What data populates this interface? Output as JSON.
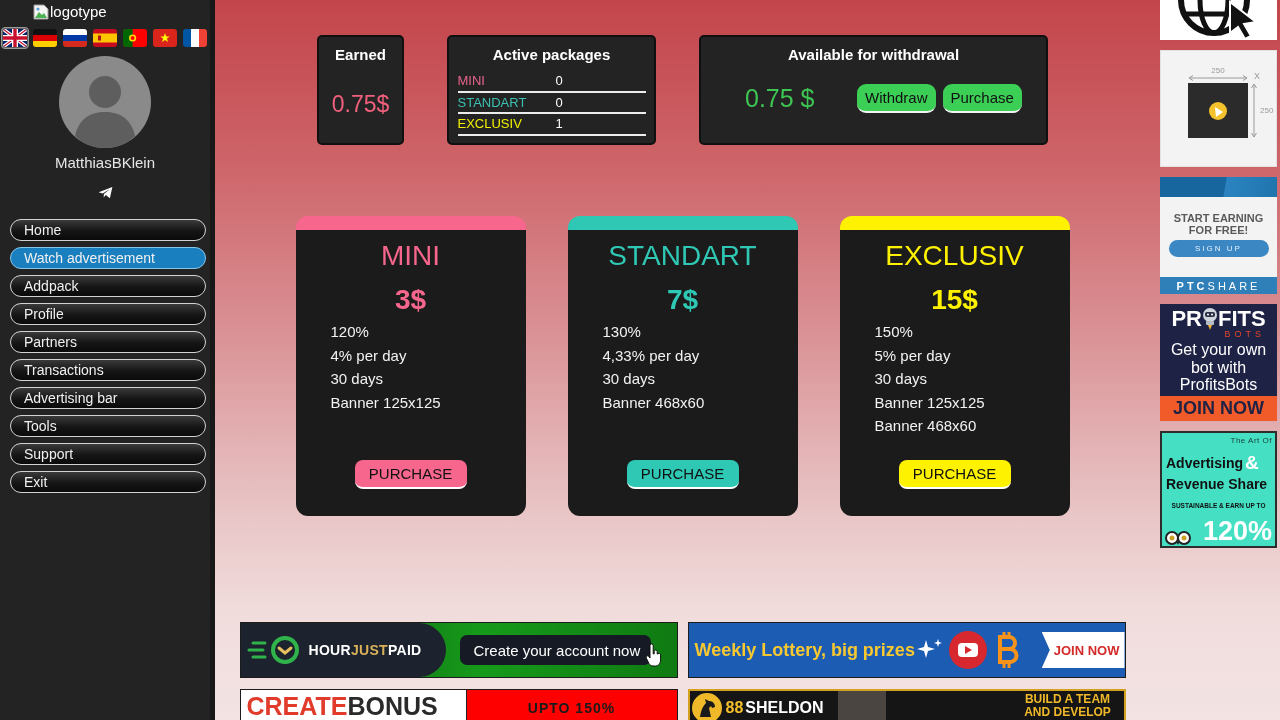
{
  "sidebar": {
    "logo": {
      "alt_text": "logotype"
    },
    "languages": [
      {
        "kind": "gb",
        "selected": true
      },
      {
        "kind": "de",
        "selected": false
      },
      {
        "kind": "ru",
        "selected": false
      },
      {
        "kind": "es",
        "selected": false
      },
      {
        "kind": "pt",
        "selected": false
      },
      {
        "kind": "vn",
        "selected": false
      },
      {
        "kind": "fr",
        "selected": false
      }
    ],
    "user": {
      "name": "MatthiasBKlein"
    },
    "menu": [
      {
        "label": "Home",
        "selected": false
      },
      {
        "label": "Watch advertisement",
        "selected": true
      },
      {
        "label": "Addpack",
        "selected": false
      },
      {
        "label": "Profile",
        "selected": false
      },
      {
        "label": "Partners",
        "selected": false
      },
      {
        "label": "Transactions",
        "selected": false
      },
      {
        "label": "Advertising bar",
        "selected": false
      },
      {
        "label": "Tools",
        "selected": false
      },
      {
        "label": "Support",
        "selected": false
      },
      {
        "label": "Exit",
        "selected": false
      }
    ]
  },
  "stats": {
    "earned": {
      "title": "Earned",
      "value": "0.75$"
    },
    "active_packages": {
      "title": "Active packages",
      "rows": [
        {
          "name": "MINI",
          "count": "0",
          "color": "#e5638a"
        },
        {
          "name": "STANDART",
          "count": "0",
          "color": "#3cc0b0"
        },
        {
          "name": "EXCLUSIV",
          "count": "1",
          "color": "#f2f000"
        }
      ]
    },
    "withdrawal": {
      "title": "Available for withdrawal",
      "value": "0.75 $",
      "buttons": [
        "Withdraw",
        "Purchase"
      ]
    }
  },
  "packages": [
    {
      "name": "MINI",
      "price": "3$",
      "color": "#f7668c",
      "features": [
        "120%",
        "4% per day",
        "30 days",
        "Banner 125x125"
      ],
      "button": "PURCHASE"
    },
    {
      "name": "STANDART",
      "price": "7$",
      "color": "#2ec8b4",
      "features": [
        "130%",
        "4,33% per day",
        "30 days",
        "Banner 468x60"
      ],
      "button": "PURCHASE"
    },
    {
      "name": "EXCLUSIV",
      "price": "15$",
      "color": "#fff200",
      "features": [
        "150%",
        "5% per day",
        "30 days",
        "Banner 125x125",
        "Banner 468x60"
      ],
      "button": "PURCHASE"
    }
  ],
  "side_banners": [
    {
      "kind": "globe"
    },
    {
      "kind": "size_placeholder",
      "width_label": "250",
      "close_mark": "X",
      "height_label": "250"
    },
    {
      "kind": "ptcshare",
      "headline": "START EARNING FOR FREE!",
      "button": "SIGN UP",
      "brand": "**PTC**SHARE"
    },
    {
      "kind": "profitsbots",
      "logo_start": "PR",
      "logo_end": "FITS",
      "logo_sub": "BOTS",
      "text": "Get your own bot with ProfitsBots",
      "cta": "JOIN NOW"
    },
    {
      "kind": "revenue_share",
      "kicker": "The Art Of",
      "headline_1": "Advertising",
      "ampersand": "&",
      "headline_2": "Revenue Share",
      "subline": "SUSTAINABLE & EARN UP TO",
      "figure": "120%"
    }
  ],
  "bottom_banners": [
    {
      "kind": "hourjustpaid",
      "brand_parts": [
        "HOUR",
        "JUST",
        "PAID"
      ],
      "button": "Create your account now"
    },
    {
      "kind": "lottery",
      "text": "Weekly Lottery, big prizes",
      "cta": "JOIN NOW"
    },
    {
      "kind": "createbonus",
      "brand_parts": [
        "CREATE",
        "BONUS"
      ],
      "offer": "UPTO 150%"
    },
    {
      "kind": "sheldon",
      "logo_mark": "88",
      "brand": "SHELDON",
      "tagline": "BUILD A TEAM AND DEVELOP"
    }
  ]
}
